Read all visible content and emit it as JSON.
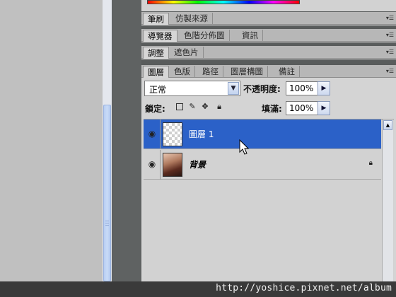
{
  "panels": {
    "brush_group": {
      "tabs": [
        "筆刷",
        "仿製來源"
      ]
    },
    "navigator_group": {
      "tabs": [
        "導覽器",
        "色階分佈圖",
        "資訊"
      ]
    },
    "adjust_group": {
      "tabs": [
        "調整",
        "遮色片"
      ]
    },
    "layers_group": {
      "tabs": [
        "圖層",
        "色版",
        "路徑",
        "圖層構圖",
        "備註"
      ]
    }
  },
  "layers": {
    "blend_mode": "正常",
    "opacity_label": "不透明度:",
    "opacity_value": "100%",
    "lock_label": "鎖定:",
    "fill_label": "填滿:",
    "fill_value": "100%",
    "items": [
      {
        "name": "圖層 1",
        "selected": true,
        "thumbnail": "transparent-checker"
      },
      {
        "name": "背景",
        "selected": false,
        "thumbnail": "photo",
        "locked": true
      }
    ]
  },
  "watermark": "http://yoshice.pixnet.net/album",
  "colors": {
    "selection": "#2b61c8",
    "panel_bg": "#d4d4d4",
    "dark_divider": "#5f6262"
  },
  "icons": [
    "eye-icon",
    "lock-icon",
    "lock-transparent-icon",
    "brush-icon",
    "move-icon",
    "panel-menu-icon",
    "dropdown-arrow-icon",
    "arrow-right-icon",
    "scroll-up-icon",
    "mouse-cursor-icon"
  ]
}
